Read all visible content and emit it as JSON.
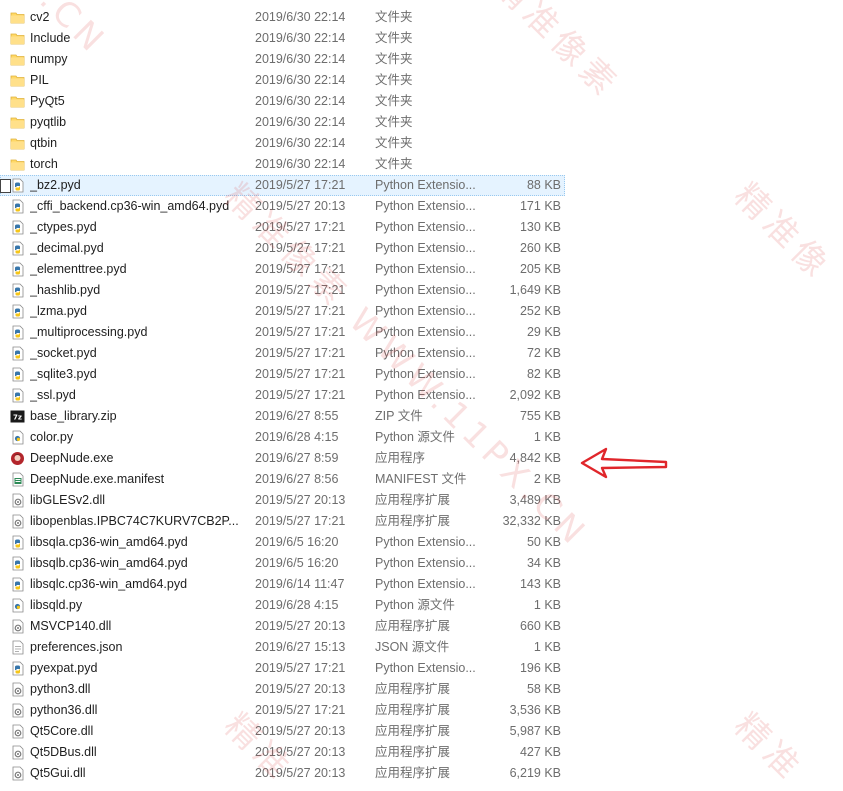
{
  "rows": [
    {
      "name": "cv2",
      "date": "2019/6/30 22:14",
      "type": "文件夹",
      "size": "",
      "icon": "folder-icon"
    },
    {
      "name": "Include",
      "date": "2019/6/30 22:14",
      "type": "文件夹",
      "size": "",
      "icon": "folder-icon"
    },
    {
      "name": "numpy",
      "date": "2019/6/30 22:14",
      "type": "文件夹",
      "size": "",
      "icon": "folder-icon"
    },
    {
      "name": "PIL",
      "date": "2019/6/30 22:14",
      "type": "文件夹",
      "size": "",
      "icon": "folder-icon"
    },
    {
      "name": "PyQt5",
      "date": "2019/6/30 22:14",
      "type": "文件夹",
      "size": "",
      "icon": "folder-icon"
    },
    {
      "name": "pyqtlib",
      "date": "2019/6/30 22:14",
      "type": "文件夹",
      "size": "",
      "icon": "folder-icon"
    },
    {
      "name": "qtbin",
      "date": "2019/6/30 22:14",
      "type": "文件夹",
      "size": "",
      "icon": "folder-icon"
    },
    {
      "name": "torch",
      "date": "2019/6/30 22:14",
      "type": "文件夹",
      "size": "",
      "icon": "folder-icon"
    },
    {
      "name": "_bz2.pyd",
      "date": "2019/5/27 17:21",
      "type": "Python Extensio...",
      "size": "88 KB",
      "icon": "python-extension-icon"
    },
    {
      "name": "_cffi_backend.cp36-win_amd64.pyd",
      "date": "2019/5/27 20:13",
      "type": "Python Extensio...",
      "size": "171 KB",
      "icon": "python-extension-icon"
    },
    {
      "name": "_ctypes.pyd",
      "date": "2019/5/27 17:21",
      "type": "Python Extensio...",
      "size": "130 KB",
      "icon": "python-extension-icon"
    },
    {
      "name": "_decimal.pyd",
      "date": "2019/5/27 17:21",
      "type": "Python Extensio...",
      "size": "260 KB",
      "icon": "python-extension-icon"
    },
    {
      "name": "_elementtree.pyd",
      "date": "2019/5/27 17:21",
      "type": "Python Extensio...",
      "size": "205 KB",
      "icon": "python-extension-icon"
    },
    {
      "name": "_hashlib.pyd",
      "date": "2019/5/27 17:21",
      "type": "Python Extensio...",
      "size": "1,649 KB",
      "icon": "python-extension-icon"
    },
    {
      "name": "_lzma.pyd",
      "date": "2019/5/27 17:21",
      "type": "Python Extensio...",
      "size": "252 KB",
      "icon": "python-extension-icon"
    },
    {
      "name": "_multiprocessing.pyd",
      "date": "2019/5/27 17:21",
      "type": "Python Extensio...",
      "size": "29 KB",
      "icon": "python-extension-icon"
    },
    {
      "name": "_socket.pyd",
      "date": "2019/5/27 17:21",
      "type": "Python Extensio...",
      "size": "72 KB",
      "icon": "python-extension-icon"
    },
    {
      "name": "_sqlite3.pyd",
      "date": "2019/5/27 17:21",
      "type": "Python Extensio...",
      "size": "82 KB",
      "icon": "python-extension-icon"
    },
    {
      "name": "_ssl.pyd",
      "date": "2019/5/27 17:21",
      "type": "Python Extensio...",
      "size": "2,092 KB",
      "icon": "python-extension-icon"
    },
    {
      "name": "base_library.zip",
      "date": "2019/6/27 8:55",
      "type": "ZIP 文件",
      "size": "755 KB",
      "icon": "zip-archive-icon"
    },
    {
      "name": "color.py",
      "date": "2019/6/28 4:15",
      "type": "Python 源文件",
      "size": "1 KB",
      "icon": "python-source-icon"
    },
    {
      "name": "DeepNude.exe",
      "date": "2019/6/27 8:59",
      "type": "应用程序",
      "size": "4,842 KB",
      "icon": "application-icon"
    },
    {
      "name": "DeepNude.exe.manifest",
      "date": "2019/6/27 8:56",
      "type": "MANIFEST 文件",
      "size": "2 KB",
      "icon": "manifest-icon"
    },
    {
      "name": "libGLESv2.dll",
      "date": "2019/5/27 20:13",
      "type": "应用程序扩展",
      "size": "3,489 KB",
      "icon": "dll-icon"
    },
    {
      "name": "libopenblas.IPBC74C7KURV7CB2P...",
      "date": "2019/5/27 17:21",
      "type": "应用程序扩展",
      "size": "32,332 KB",
      "icon": "dll-icon"
    },
    {
      "name": "libsqla.cp36-win_amd64.pyd",
      "date": "2019/6/5 16:20",
      "type": "Python Extensio...",
      "size": "50 KB",
      "icon": "python-extension-icon"
    },
    {
      "name": "libsqlb.cp36-win_amd64.pyd",
      "date": "2019/6/5 16:20",
      "type": "Python Extensio...",
      "size": "34 KB",
      "icon": "python-extension-icon"
    },
    {
      "name": "libsqlc.cp36-win_amd64.pyd",
      "date": "2019/6/14 11:47",
      "type": "Python Extensio...",
      "size": "143 KB",
      "icon": "python-extension-icon"
    },
    {
      "name": "libsqld.py",
      "date": "2019/6/28 4:15",
      "type": "Python 源文件",
      "size": "1 KB",
      "icon": "python-source-icon"
    },
    {
      "name": "MSVCP140.dll",
      "date": "2019/5/27 20:13",
      "type": "应用程序扩展",
      "size": "660 KB",
      "icon": "dll-icon"
    },
    {
      "name": "preferences.json",
      "date": "2019/6/27 15:13",
      "type": "JSON 源文件",
      "size": "1 KB",
      "icon": "json-file-icon"
    },
    {
      "name": "pyexpat.pyd",
      "date": "2019/5/27 17:21",
      "type": "Python Extensio...",
      "size": "196 KB",
      "icon": "python-extension-icon"
    },
    {
      "name": "python3.dll",
      "date": "2019/5/27 20:13",
      "type": "应用程序扩展",
      "size": "58 KB",
      "icon": "dll-icon"
    },
    {
      "name": "python36.dll",
      "date": "2019/5/27 17:21",
      "type": "应用程序扩展",
      "size": "3,536 KB",
      "icon": "dll-icon"
    },
    {
      "name": "Qt5Core.dll",
      "date": "2019/5/27 20:13",
      "type": "应用程序扩展",
      "size": "5,987 KB",
      "icon": "dll-icon"
    },
    {
      "name": "Qt5DBus.dll",
      "date": "2019/5/27 20:13",
      "type": "应用程序扩展",
      "size": "427 KB",
      "icon": "dll-icon"
    },
    {
      "name": "Qt5Gui.dll",
      "date": "2019/5/27 20:13",
      "type": "应用程序扩展",
      "size": "6,219 KB",
      "icon": "dll-icon"
    }
  ],
  "selected_index": 8,
  "watermark": {
    "image": true,
    "color": "#dc3c3c"
  },
  "annotation": {
    "arrow_icon": "red-arrow-icon",
    "arrow_color": "#e0262b",
    "points_to_row": 21
  },
  "colors": {
    "folder": "#ffd866",
    "selection": "#e5f3ff",
    "secondary_text": "#6d6d6d"
  }
}
